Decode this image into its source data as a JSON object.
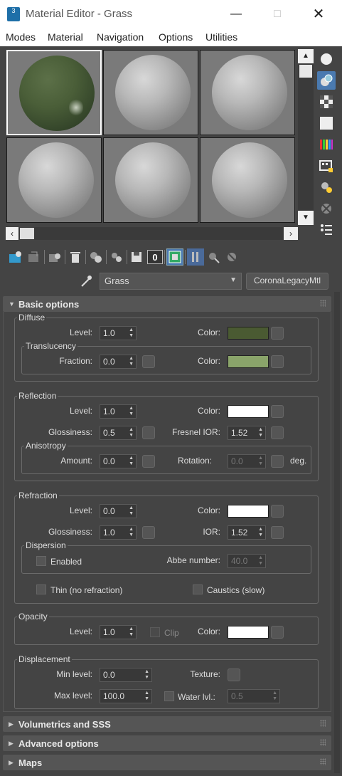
{
  "window": {
    "title": "Material Editor - Grass",
    "app_icon_text": "3"
  },
  "menubar": {
    "items": [
      "Modes",
      "Material",
      "Navigation",
      "Options",
      "Utilities"
    ]
  },
  "material": {
    "name": "Grass",
    "type": "CoronaLegacyMtl"
  },
  "toolbar": {
    "count_label": "0"
  },
  "rollouts": {
    "basic": "Basic options",
    "volumetrics": "Volumetrics and SSS",
    "advanced": "Advanced options",
    "maps": "Maps"
  },
  "diffuse": {
    "group": "Diffuse",
    "level_label": "Level:",
    "level": "1.0",
    "color_label": "Color:",
    "color": "#4a5a32",
    "translucency": {
      "group": "Translucency",
      "fraction_label": "Fraction:",
      "fraction": "0.0",
      "color_label": "Color:",
      "color": "#8aa46a"
    }
  },
  "reflection": {
    "group": "Reflection",
    "level_label": "Level:",
    "level": "1.0",
    "color_label": "Color:",
    "color": "#ffffff",
    "gloss_label": "Glossiness:",
    "gloss": "0.5",
    "fresnel_label": "Fresnel IOR:",
    "fresnel": "1.52",
    "anisotropy": {
      "group": "Anisotropy",
      "amount_label": "Amount:",
      "amount": "0.0",
      "rotation_label": "Rotation:",
      "rotation": "0.0",
      "deg": "deg."
    }
  },
  "refraction": {
    "group": "Refraction",
    "level_label": "Level:",
    "level": "0.0",
    "color_label": "Color:",
    "color": "#ffffff",
    "gloss_label": "Glossiness:",
    "gloss": "1.0",
    "ior_label": "IOR:",
    "ior": "1.52",
    "dispersion": {
      "group": "Dispersion",
      "enabled_label": "Enabled",
      "abbe_label": "Abbe number:",
      "abbe": "40.0"
    },
    "thin_label": "Thin (no refraction)",
    "caustics_label": "Caustics (slow)"
  },
  "opacity": {
    "group": "Opacity",
    "level_label": "Level:",
    "level": "1.0",
    "clip_label": "Clip",
    "color_label": "Color:",
    "color": "#ffffff"
  },
  "displacement": {
    "group": "Displacement",
    "min_label": "Min level:",
    "min": "0.0",
    "texture_label": "Texture:",
    "max_label": "Max level:",
    "max": "100.0",
    "water_label": "Water lvl.:",
    "water": "0.5"
  }
}
